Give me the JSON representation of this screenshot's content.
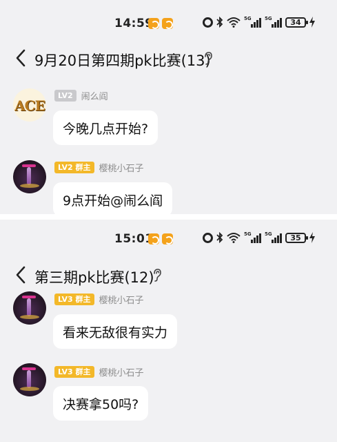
{
  "screens": [
    {
      "status_bar": {
        "time": "14:59",
        "network_tag_1": "5G",
        "network_tag_2": "5G",
        "battery": "34"
      },
      "header": {
        "title": "9月20日第四期pk比赛(13)"
      },
      "messages": [
        {
          "avatar_text": "ACE",
          "level": "LV2",
          "nickname": "闹么阎",
          "text": "今晚几点开始?"
        },
        {
          "level": "LV2 群主",
          "nickname": "樱桃小石子",
          "text": "9点开始@闹么阎"
        }
      ]
    },
    {
      "status_bar": {
        "time": "15:01",
        "network_tag_1": "5G",
        "network_tag_2": "5G",
        "battery": "35"
      },
      "header": {
        "title": "第三期pk比赛(12)"
      },
      "messages": [
        {
          "level": "LV3 群主",
          "nickname": "樱桃小石子",
          "text": "看来无敌很有实力"
        },
        {
          "level": "LV3 群主",
          "nickname": "樱桃小石子",
          "text": "决赛拿50吗?"
        }
      ]
    }
  ],
  "colors": {
    "chat_bg": "#f1f1f3",
    "bubble_bg": "#ffffff",
    "level_grey": "#c9c9cc",
    "level_gold": "#f3b829",
    "app_badge": "#f4a21b"
  },
  "icons": [
    "back-arrow-icon",
    "ear-icon",
    "alarm-icon",
    "bluetooth-icon",
    "wifi-icon",
    "signal-icon",
    "battery-icon",
    "charging-icon",
    "app-notification-icon"
  ]
}
